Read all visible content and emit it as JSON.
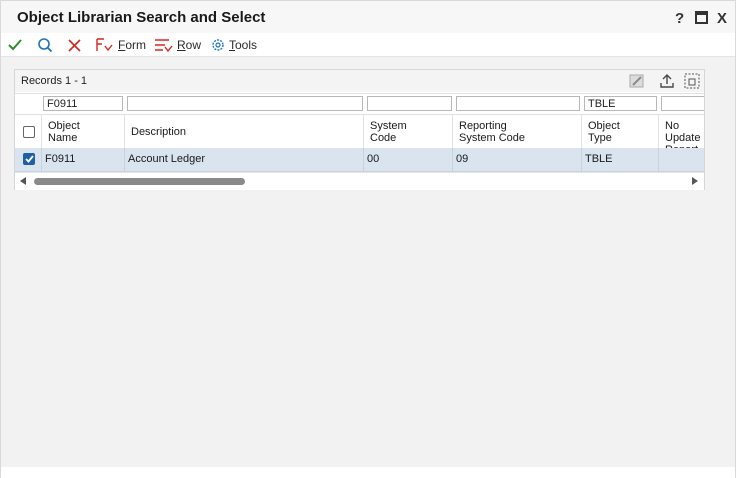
{
  "window": {
    "title": "Object Librarian Search and Select",
    "help_label": "?",
    "close_label": "X"
  },
  "toolbar": {
    "form_label_u": "F",
    "form_label_rest": "orm",
    "row_label_u": "R",
    "row_label_rest": "ow",
    "tools_label_u": "T",
    "tools_label_rest": "ools"
  },
  "grid": {
    "records_text": "Records 1 - 1",
    "filters": {
      "object_name": "F0911",
      "description": "",
      "system_code": "",
      "reporting_system_code": "",
      "object_type": "TBLE",
      "no_update_report": ""
    },
    "columns": [
      "Object\nName",
      "Description",
      "System\nCode",
      "Reporting\nSystem Code",
      "Object\nType",
      "No Update\nReport"
    ],
    "rows": [
      {
        "selected": true,
        "object_name": "F0911",
        "description": "Account Ledger",
        "system_code": "00",
        "reporting_system_code": "09",
        "object_type": "TBLE",
        "no_update_report": ""
      }
    ]
  },
  "colors": {
    "accent": "#1e5fa6",
    "ok_green": "#2e8b2e",
    "cancel_red": "#d9251d",
    "selected_row": "#d9e4ee"
  },
  "icons": [
    "check-icon",
    "search-icon",
    "close-x-icon",
    "form-menu-icon",
    "row-menu-icon",
    "tools-gear-icon",
    "edit-icon",
    "export-icon",
    "grid-layout-icon",
    "minimize-icon",
    "maximize-icon"
  ]
}
